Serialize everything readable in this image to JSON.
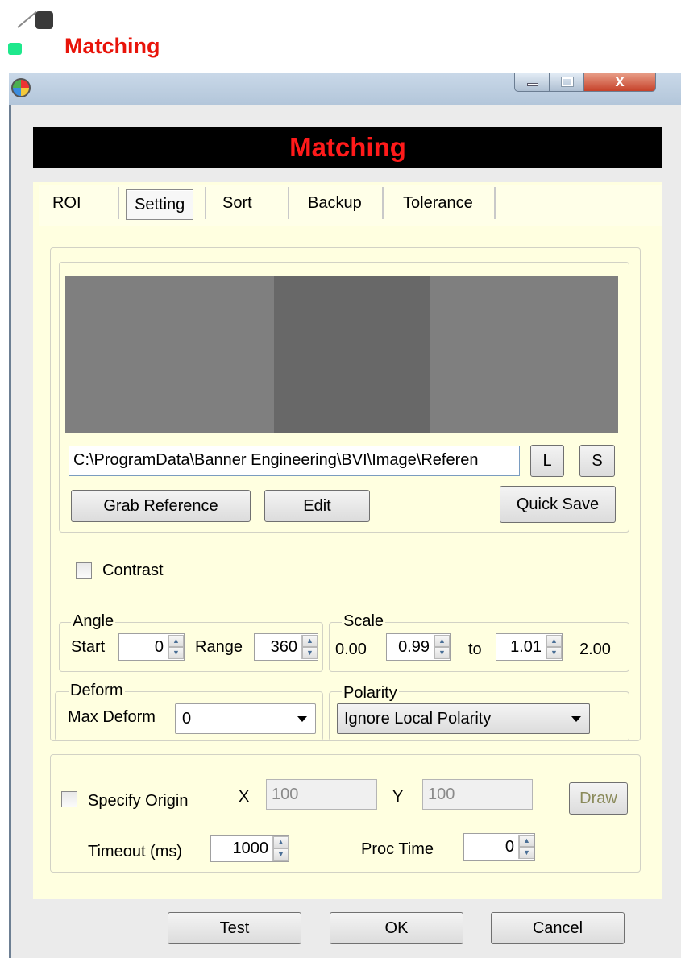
{
  "doc_header": {
    "title": "Matching"
  },
  "window": {
    "title_buttons": {
      "close": "x"
    },
    "banner_title": "Matching"
  },
  "tabs": [
    {
      "label": "ROI",
      "active": false
    },
    {
      "label": "Setting",
      "active": true
    },
    {
      "label": "Sort",
      "active": false
    },
    {
      "label": "Backup",
      "active": false
    },
    {
      "label": "Tolerance",
      "active": false
    }
  ],
  "reference": {
    "path": "C:\\ProgramData\\Banner Engineering\\BVI\\Image\\Referen",
    "load_label": "L",
    "save_label": "S",
    "grab_label": "Grab Reference",
    "edit_label": "Edit",
    "quick_save_label": "Quick Save"
  },
  "contrast": {
    "label": "Contrast",
    "checked": false
  },
  "angle": {
    "group_label": "Angle",
    "start_label": "Start",
    "start_value": "0",
    "range_label": "Range",
    "range_value": "360"
  },
  "scale": {
    "group_label": "Scale",
    "min_label": "0.00",
    "from_value": "0.99",
    "to_label": "to",
    "to_value": "1.01",
    "max_label": "2.00"
  },
  "deform": {
    "group_label": "Deform",
    "max_label": "Max Deform",
    "value": "0"
  },
  "polarity": {
    "group_label": "Polarity",
    "value": "Ignore Local Polarity"
  },
  "origin": {
    "checkbox_label": "Specify Origin",
    "checked": false,
    "x_label": "X",
    "x_value": "100",
    "y_label": "Y",
    "y_value": "100",
    "draw_label": "Draw"
  },
  "timing": {
    "timeout_label": "Timeout (ms)",
    "timeout_value": "1000",
    "proc_label": "Proc Time",
    "proc_value": "0"
  },
  "footer": {
    "test_label": "Test",
    "ok_label": "OK",
    "cancel_label": "Cancel"
  }
}
